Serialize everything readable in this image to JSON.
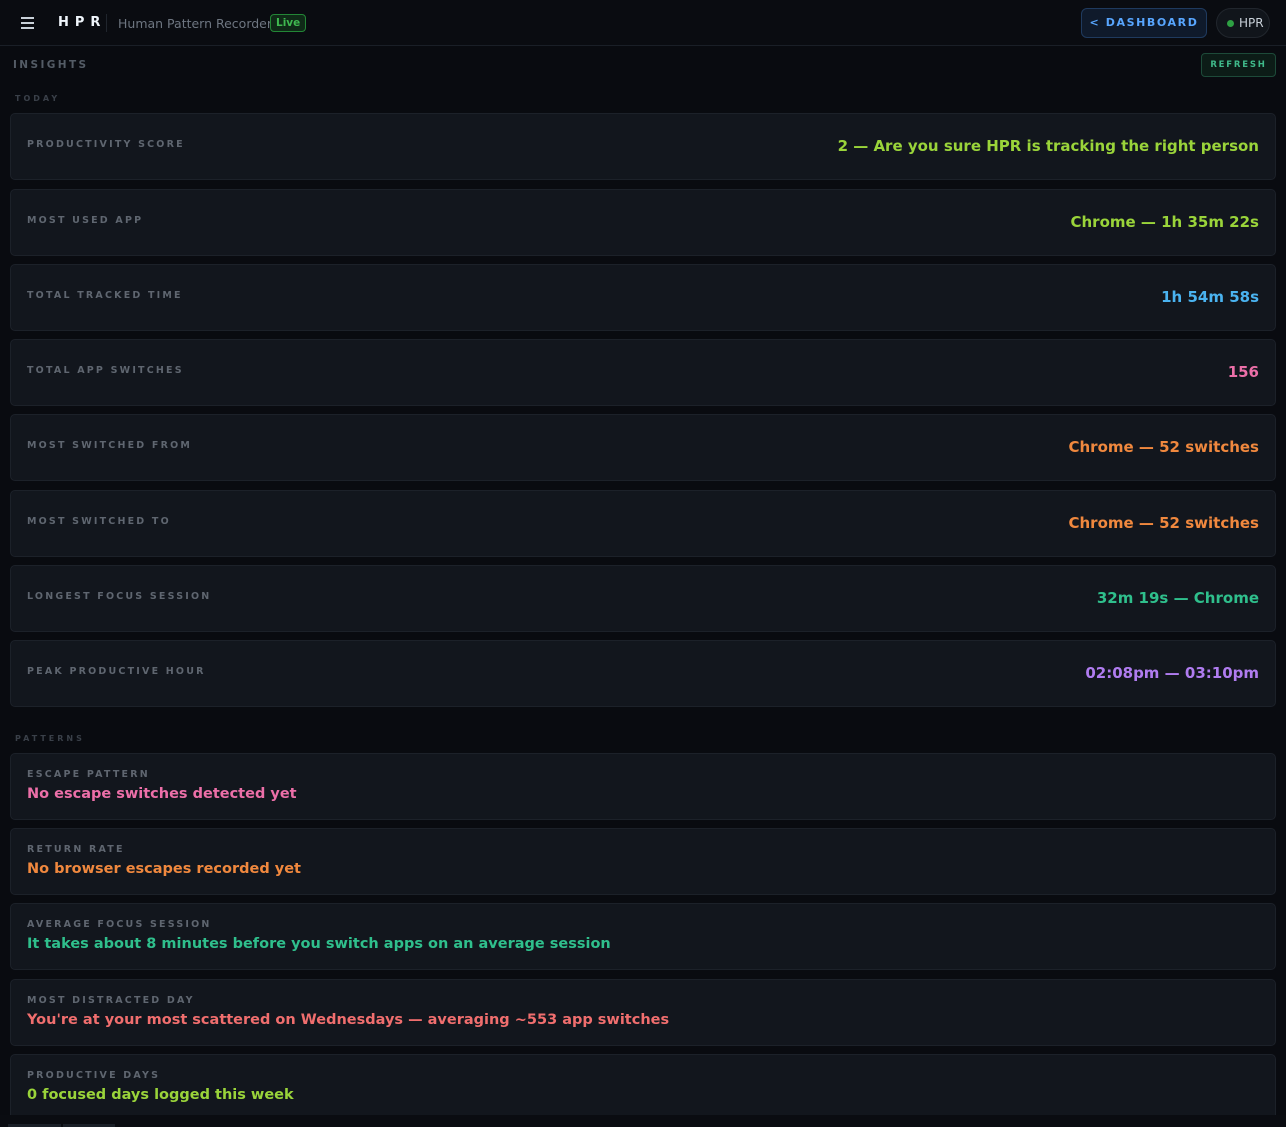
{
  "header": {
    "brand": "HPR",
    "subtitle": "Human Pattern Recorder",
    "live_badge": "Live",
    "dashboard_button": "< DASHBOARD",
    "profile_label": "HPR"
  },
  "page": {
    "title": "INSIGHTS",
    "refresh_button": "REFRESH"
  },
  "today": {
    "section_label": "TODAY",
    "rows": [
      {
        "label": "PRODUCTIVITY SCORE",
        "value": "2 — Are you sure HPR is tracking the right person",
        "color": "#9ad43a"
      },
      {
        "label": "MOST USED APP",
        "value": "Chrome — 1h 35m 22s",
        "color": "#9ad43a"
      },
      {
        "label": "TOTAL TRACKED TIME",
        "value": "1h 54m 58s",
        "color": "#4ab3f0"
      },
      {
        "label": "TOTAL APP SWITCHES",
        "value": "156",
        "color": "#ec6fa8"
      },
      {
        "label": "MOST SWITCHED FROM",
        "value": "Chrome — 52 switches",
        "color": "#f0883e"
      },
      {
        "label": "MOST SWITCHED TO",
        "value": "Chrome — 52 switches",
        "color": "#f0883e"
      },
      {
        "label": "LONGEST FOCUS SESSION",
        "value": "32m 19s — Chrome",
        "color": "#2fbf8c"
      },
      {
        "label": "PEAK PRODUCTIVE HOUR",
        "value": "02:08pm — 03:10pm",
        "color": "#b07cf0"
      }
    ]
  },
  "patterns": {
    "section_label": "PATTERNS",
    "rows": [
      {
        "label": "ESCAPE PATTERN",
        "value": "No escape switches detected yet",
        "color": "#ec6fa8"
      },
      {
        "label": "RETURN RATE",
        "value": "No browser escapes recorded yet",
        "color": "#f0883e"
      },
      {
        "label": "AVERAGE FOCUS SESSION",
        "value": "It takes about 8 minutes before you switch apps on an average session",
        "color": "#2fbf8c"
      },
      {
        "label": "MOST DISTRACTED DAY",
        "value": "You're at your most scattered on Wednesdays — averaging ~553 app switches",
        "color": "#f06e6e"
      },
      {
        "label": "PRODUCTIVE DAYS",
        "value": "0 focused days logged this week",
        "color": "#9ad43a"
      }
    ]
  }
}
